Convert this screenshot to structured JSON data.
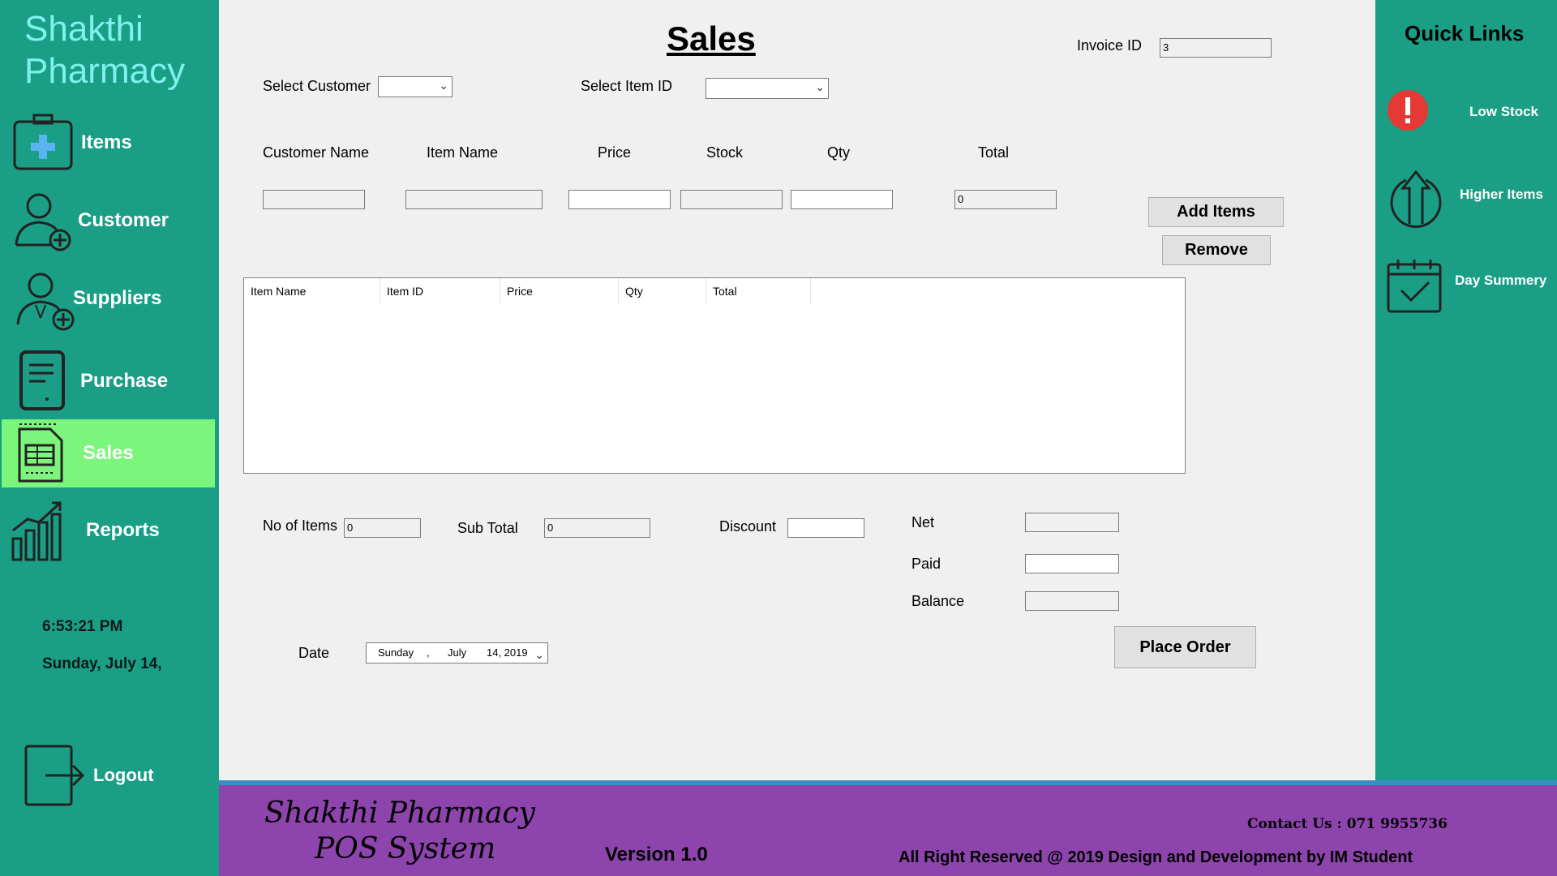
{
  "brand": {
    "line1": "Shakthi",
    "line2": "Pharmacy"
  },
  "sidebar": {
    "items": [
      {
        "label": "Items",
        "icon": "medical-kit-icon"
      },
      {
        "label": "Customer",
        "icon": "add-customer-icon"
      },
      {
        "label": "Suppliers",
        "icon": "add-supplier-icon"
      },
      {
        "label": "Purchase",
        "icon": "document-icon"
      },
      {
        "label": "Sales",
        "icon": "receipt-icon",
        "active": true
      },
      {
        "label": "Reports",
        "icon": "bar-chart-icon"
      }
    ],
    "time": "6:53:21 PM",
    "date": "Sunday, July 14,",
    "logout": "Logout"
  },
  "sales": {
    "title": "Sales",
    "invoice_label": "Invoice ID",
    "invoice_value": "3",
    "select_customer_label": "Select Customer",
    "select_item_label": "Select Item ID",
    "col_customer_name": "Customer Name",
    "col_item_name": "Item Name",
    "col_price": "Price",
    "col_stock": "Stock",
    "col_qty": "Qty",
    "col_total": "Total",
    "total_value": "0",
    "add_items": "Add Items",
    "remove": "Remove",
    "grid_headers": [
      "Item Name",
      "Item ID",
      "Price",
      "Qty",
      "Total"
    ],
    "no_of_items_label": "No of Items",
    "no_of_items_value": "0",
    "sub_total_label": "Sub Total",
    "sub_total_value": "0",
    "discount_label": "Discount",
    "net_label": "Net",
    "paid_label": "Paid",
    "balance_label": "Balance",
    "date_label": "Date",
    "date_day": "Sunday",
    "date_sep": ",",
    "date_month": "July",
    "date_rest": "14, 2019",
    "place_order": "Place Order"
  },
  "quick_links": {
    "title": "Quick Links",
    "items": [
      {
        "label": "Low Stock",
        "icon": "alert-icon"
      },
      {
        "label": "Higher Items",
        "icon": "up-arrow-circle-icon"
      },
      {
        "label": "Day Summery",
        "icon": "calendar-check-icon"
      }
    ]
  },
  "footer": {
    "title_line1": "Shakthi Pharmacy",
    "title_line2": "POS System",
    "version": "Version 1.0",
    "contact": "Contact Us : 071 9955736",
    "rights": "All Right Reserved @ 2019 Design and Development by IM Student"
  },
  "colors": {
    "teal": "#1a9e86",
    "active": "#7bf57b",
    "footer": "#8e44ad",
    "brand": "#7ff1ec",
    "alert": "#e53935"
  }
}
